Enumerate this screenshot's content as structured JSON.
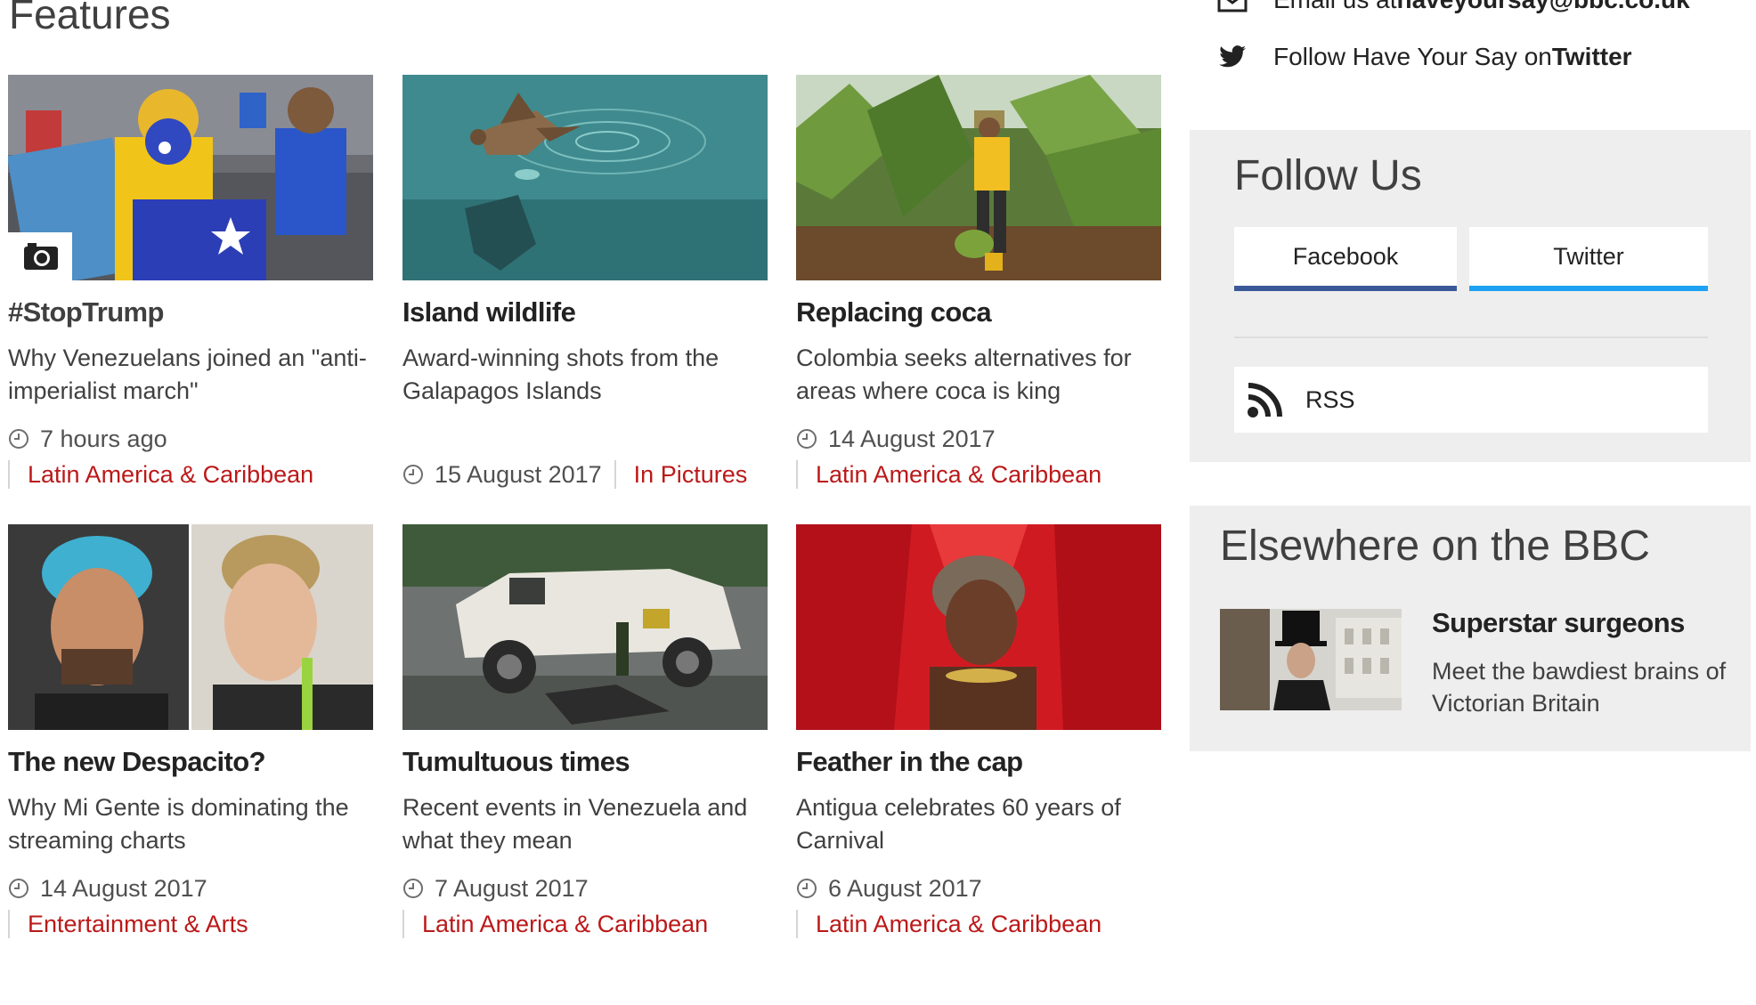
{
  "features": {
    "heading": "Features",
    "cards": [
      {
        "title": "#StopTrump",
        "summary": "Why Venezuelans joined an \"anti-imperialist march\"",
        "date": "7 hours ago",
        "tag": "Latin America & Caribbean",
        "image_icon": "photo-gallery-camera-icon"
      },
      {
        "title": "Island wildlife",
        "summary": "Award-winning shots from the Galapagos Islands",
        "date": "15 August 2017",
        "tag": "In Pictures"
      },
      {
        "title": "Replacing coca",
        "summary": "Colombia seeks alternatives for areas where coca is king",
        "date": "14 August 2017",
        "tag": "Latin America & Caribbean"
      },
      {
        "title": "The new Despacito?",
        "summary": "Why Mi Gente is dominating the streaming charts",
        "date": "14 August 2017",
        "tag": "Entertainment & Arts"
      },
      {
        "title": "Tumultuous times",
        "summary": "Recent events in Venezuela and what they mean",
        "date": "7 August 2017",
        "tag": "Latin America & Caribbean"
      },
      {
        "title": "Feather in the cap",
        "summary": "Antigua celebrates 60 years of Carnival",
        "date": "6 August 2017",
        "tag": "Latin America & Caribbean"
      }
    ]
  },
  "contact": {
    "email_prefix": "Email us at ",
    "email_address": "haveyoursay@bbc.co.uk",
    "twitter_prefix": "Follow Have Your Say on ",
    "twitter_strong": "Twitter"
  },
  "follow_us": {
    "title": "Follow Us",
    "facebook_label": "Facebook",
    "twitter_label": "Twitter",
    "rss_label": "RSS"
  },
  "elsewhere": {
    "title": "Elsewhere on the BBC",
    "promo_title": "Superstar surgeons",
    "promo_summary": "Meet the bawdiest brains of Victorian Britain"
  },
  "colors": {
    "tag_red": "#bb1919",
    "facebook_blue": "#3b5998",
    "twitter_blue": "#1da1f2",
    "panel_grey": "#eeeeee"
  }
}
